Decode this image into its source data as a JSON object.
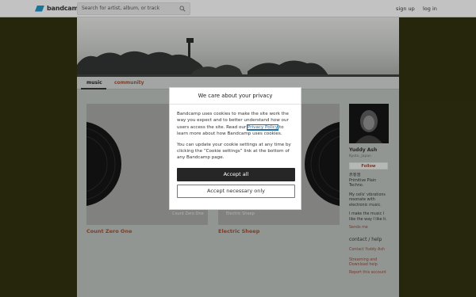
{
  "topbar": {
    "logo_text": "bandcamp",
    "search_placeholder": "Search for artist, album, or track",
    "sign_up": "sign up",
    "log_in": "log in"
  },
  "nav": {
    "music": "music",
    "community": "community"
  },
  "albums": [
    {
      "title": "Count Zero One",
      "cover_label": "Count Zero One"
    },
    {
      "title": "Electric Sheep",
      "cover_label": "Electric Sheep"
    }
  ],
  "artist": {
    "name": "Yuddy Ash",
    "location": "Kyoto, Japan",
    "follow": "Follow",
    "bio_lines": [
      "赤巻澄",
      "Primitive Plain",
      "Techno.",
      "",
      "My cells' vibrations",
      "resonate with",
      "electronic music.",
      "",
      "I make the music I",
      "like the way I like it."
    ],
    "send_me": "Sends me",
    "contact_title": "contact / help",
    "links": [
      "Contact Yuddy Ash",
      "Streaming and Download help",
      "Report this account"
    ]
  },
  "cookie_dialog": {
    "title": "We care about your privacy",
    "p1_before": "Bandcamp uses cookies to make the site work the way you expect and to better understand how our users access the site. Read our ",
    "policy_link": "Privacy Policy",
    "p1_after": " to learn more about how Bandcamp uses cookies.",
    "p2": "You can update your cookie settings at any time by clicking the “Cookie settings” link at the bottom of any Bandcamp page.",
    "accept_all": "Accept all",
    "accept_necessary": "Accept necessary only"
  },
  "colors": {
    "outer_background": "#2e2f0f",
    "page_background": "#b2b7b4",
    "link_color": "#8a4636",
    "album_title_color": "#9c4a2e",
    "accept_button": "#262626",
    "logo_blue": "#1c8fbf"
  }
}
